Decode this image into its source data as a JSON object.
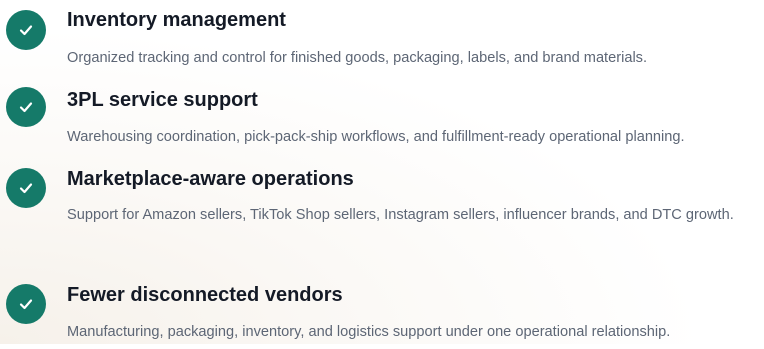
{
  "accent_color": "#157a69",
  "title_color": "#141a26",
  "description_color": "#5d6675",
  "features": [
    {
      "icon": "check-icon",
      "title": "Inventory management",
      "description": "Organized tracking and control for finished goods, packaging, labels, and brand materials."
    },
    {
      "icon": "check-icon",
      "title": "3PL service support",
      "description": "Warehousing coordination, pick-pack-ship workflows, and fulfillment-ready operational planning."
    },
    {
      "icon": "check-icon",
      "title": "Marketplace-aware operations",
      "description": "Support for Amazon sellers, TikTok Shop sellers, Instagram sellers, influencer brands, and DTC growth."
    },
    {
      "icon": "check-icon",
      "title": "Fewer disconnected vendors",
      "description": "Manufacturing, packaging, inventory, and logistics support under one operational relationship."
    }
  ]
}
